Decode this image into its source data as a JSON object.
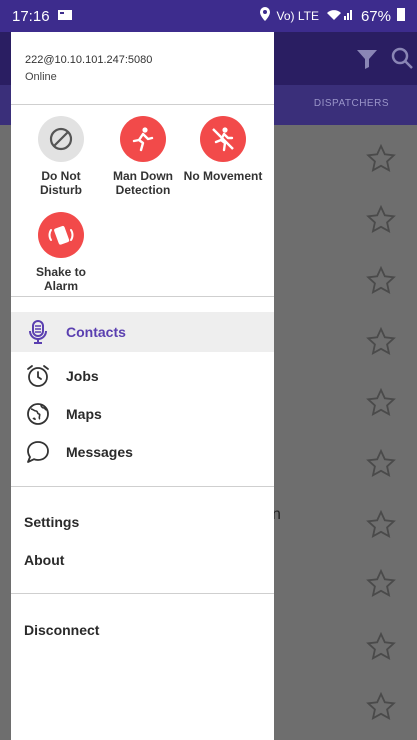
{
  "status_bar": {
    "time": "17:16",
    "battery": "67%",
    "network_badge": "Vo) LTE"
  },
  "account": {
    "address": "222@10.10.101.247:5080",
    "status": "Online"
  },
  "quick_actions": [
    {
      "label_line1": "Do Not",
      "label_line2": "Disturb",
      "icon": "do-not-disturb-icon"
    },
    {
      "label_line1": "Man Down",
      "label_line2": "Detection",
      "icon": "man-down-icon"
    },
    {
      "label_line1": "No Movement",
      "label_line2": "",
      "icon": "no-movement-icon"
    },
    {
      "label_line1": "Shake to",
      "label_line2": "Alarm",
      "icon": "shake-icon"
    }
  ],
  "nav": [
    {
      "label": "Contacts",
      "icon": "microphone-icon",
      "active": true
    },
    {
      "label": "Jobs",
      "icon": "alarm-clock-icon",
      "active": false
    },
    {
      "label": "Maps",
      "icon": "globe-icon",
      "active": false
    },
    {
      "label": "Messages",
      "icon": "chat-bubble-icon",
      "active": false
    }
  ],
  "menu": {
    "settings": "Settings",
    "about": "About",
    "disconnect": "Disconnect"
  },
  "background": {
    "tab_label": "DISPATCHERS",
    "fragment": "n"
  },
  "colors": {
    "brand_dark": "#2a1e62",
    "status_bar": "#3d2c8d",
    "accent": "#5a3fb0",
    "alert_red": "#f24a4a"
  }
}
